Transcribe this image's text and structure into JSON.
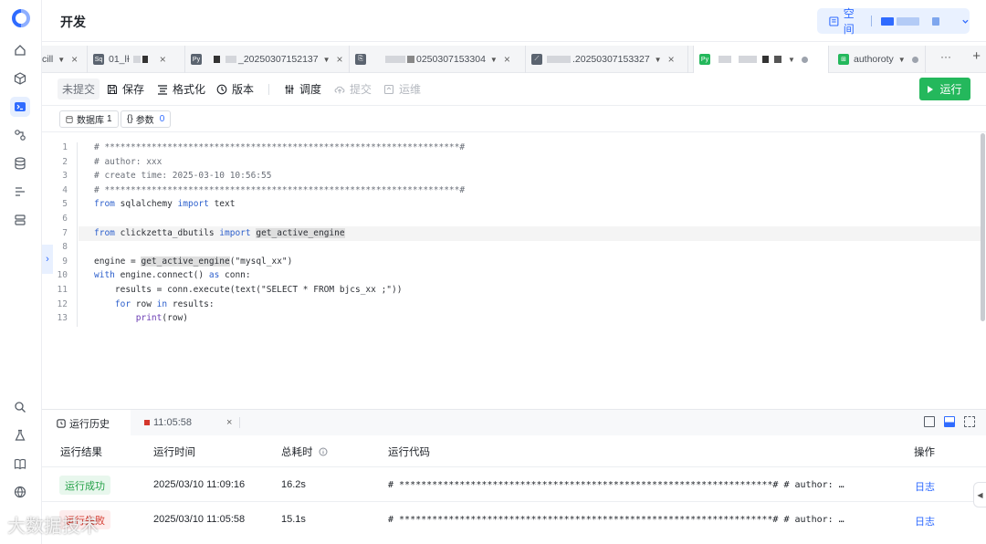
{
  "header": {
    "title": "开发"
  },
  "space": {
    "label": "空间"
  },
  "tabs": [
    {
      "label": "cill",
      "badge": ""
    },
    {
      "label": "01_lƗ",
      "badge": "Sq"
    },
    {
      "label": "_20250307152137",
      "badge": "Py"
    },
    {
      "label": "0250307153304",
      "badge": "Py"
    },
    {
      "label": ".20250307153327",
      "badge": ""
    },
    {
      "label": "",
      "badge": "Py"
    },
    {
      "label": "authoroty",
      "badge": ""
    }
  ],
  "tabs_more": "···",
  "tabs_add": "+",
  "toolbar": {
    "status": "未提交",
    "save": "保存",
    "format": "格式化",
    "version": "版本",
    "debug": "调度",
    "submit": "提交",
    "ops": "运维",
    "run": "运行"
  },
  "subbar": {
    "database_label": "数据库",
    "database_count": "1",
    "params_label": "参数",
    "params_count": "0"
  },
  "code_lines": [
    "# ********************************************************************#",
    "# author: xxx",
    "# create time: 2025-03-10 10:56:55",
    "# ********************************************************************#",
    "from sqlalchemy import text",
    "",
    "from clickzetta_dbutils import get_active_engine",
    "",
    "engine = get_active_engine(\"mysql_xx\")",
    "with engine.connect() as conn:",
    "    results = conn.execute(text(\"SELECT * FROM bjcs_xx ;\"))",
    "    for row in results:",
    "        print(row)"
  ],
  "line_numbers": [
    "1",
    "2",
    "3",
    "4",
    "5",
    "6",
    "7",
    "8",
    "9",
    "10",
    "11",
    "12",
    "13"
  ],
  "panel": {
    "tab_history": "运行历史",
    "tab_run": "11:05:58",
    "close": "×",
    "headers": {
      "result": "运行结果",
      "time": "运行时间",
      "duration": "总耗时",
      "code": "运行代码",
      "action": "操作"
    },
    "rows": [
      {
        "status": "运行成功",
        "status_type": "ok",
        "time": "2025/03/10 11:09:16",
        "duration": "16.2s",
        "code": "# ********************************************************************# # author: …",
        "action": "日志"
      },
      {
        "status": "运行失败",
        "status_type": "fail",
        "time": "2025/03/10 11:05:58",
        "duration": "15.1s",
        "code": "# ********************************************************************# # author: …",
        "action": "日志"
      }
    ]
  },
  "watermark": "大数据技术",
  "colors": {
    "accent": "#2f6bff",
    "run_green": "#24b85c",
    "success": "#24a148",
    "fail": "#d4372c"
  }
}
